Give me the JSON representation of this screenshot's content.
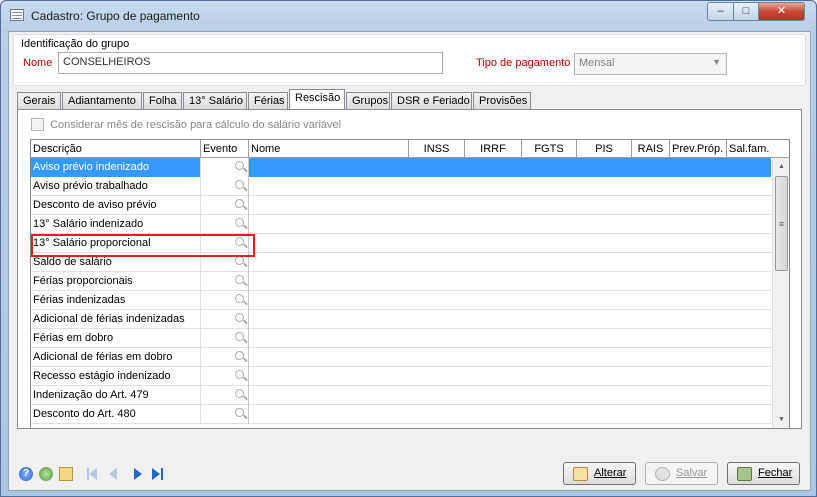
{
  "window": {
    "title": "Cadastro: Grupo de pagamento",
    "controls": {
      "minimize": "–",
      "maximize": "□",
      "close": "✕"
    }
  },
  "identification": {
    "group_title": "Identificação do grupo",
    "name_label": "Nome",
    "name_value": "CONSELHEIROS",
    "payment_type_label": "Tipo de pagamento",
    "payment_type_value": "Mensal"
  },
  "tabs": [
    {
      "label": "Gerais"
    },
    {
      "label": "Adiantamento"
    },
    {
      "label": "Folha"
    },
    {
      "label": "13° Salário"
    },
    {
      "label": "Férias"
    },
    {
      "label": "Rescisão",
      "active": true
    },
    {
      "label": "Grupos"
    },
    {
      "label": "DSR e Feriado"
    },
    {
      "label": "Provisões"
    }
  ],
  "rescisao": {
    "checkbox_label": "Considerar mês de rescisão para cálculo do salário variável",
    "columns": [
      "Descrição",
      "Evento",
      "Nome",
      "INSS",
      "IRRF",
      "FGTS",
      "PIS",
      "RAIS",
      "Prev.Próp.",
      "Sal.fam."
    ],
    "rows": [
      "Aviso prévio indenizado",
      "Aviso prévio trabalhado",
      "Desconto de aviso prévio",
      "13° Salário indenizado",
      "13° Salário proporcional",
      "Saldo de salário",
      "Férias proporcionais",
      "Férias indenizadas",
      "Adicional de férias indenizadas",
      "Férias em dobro",
      "Adicional de férias em dobro",
      "Recesso estágio indenizado",
      "Indenização do Art. 479",
      "Desconto do Art. 480"
    ],
    "selected_row": 0,
    "highlighted_row": 4
  },
  "footer": {
    "alterar_label": "Alterar",
    "salvar_label": "Salvar",
    "fechar_label": "Fechar",
    "help_glyph": "?"
  },
  "colors": {
    "accent_red": "#c00000",
    "selection": "#3399ff",
    "highlight_border": "#e02020"
  }
}
